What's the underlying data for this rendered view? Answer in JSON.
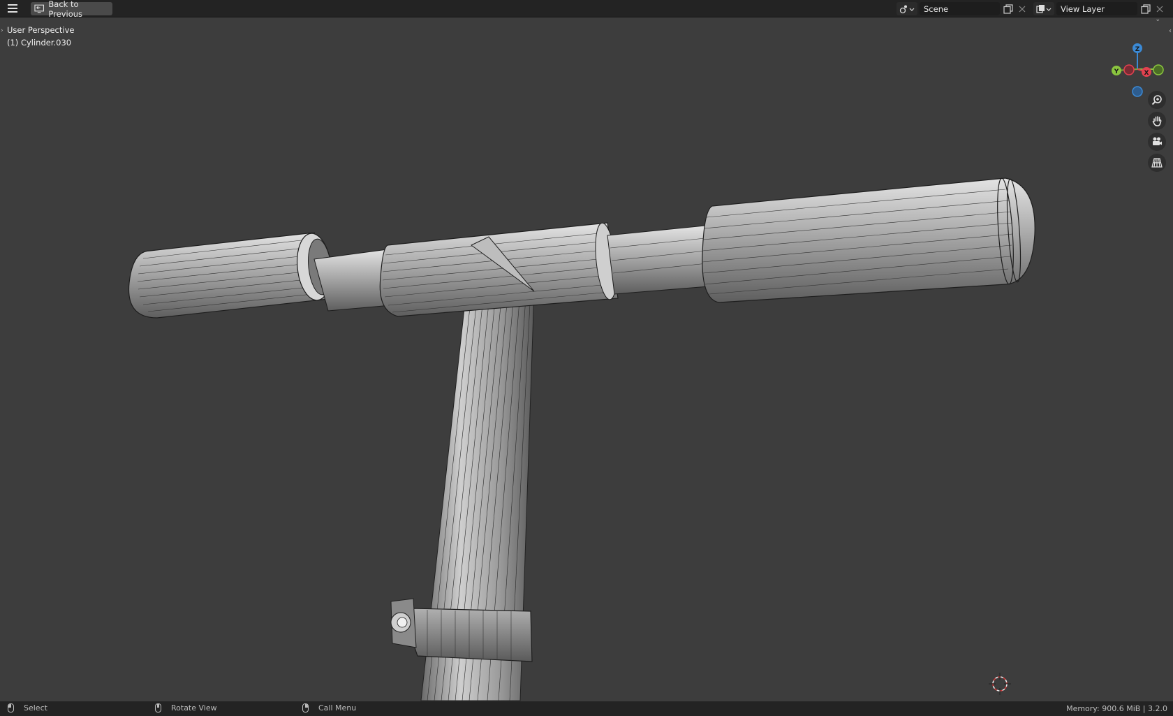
{
  "topbar": {
    "back_label": "Back to Previous",
    "scene_name": "Scene",
    "view_layer_name": "View Layer"
  },
  "viewport": {
    "view_name": "User Perspective",
    "object_label": "(1) Cylinder.030",
    "gizmo": {
      "z": "Z",
      "y": "Y",
      "x": "X"
    },
    "axis_colors": {
      "x": "#e2414f",
      "y": "#8bc53f",
      "z": "#3b8ad6"
    },
    "nav_tools": [
      "zoom-icon",
      "hand-pan-icon",
      "camera-icon",
      "grid-perspective-icon"
    ]
  },
  "statusbar": {
    "select_label": "Select",
    "rotate_label": "Rotate View",
    "call_menu_label": "Call Menu",
    "memory": "Memory: 900.6 MiB | 3.2.0"
  }
}
